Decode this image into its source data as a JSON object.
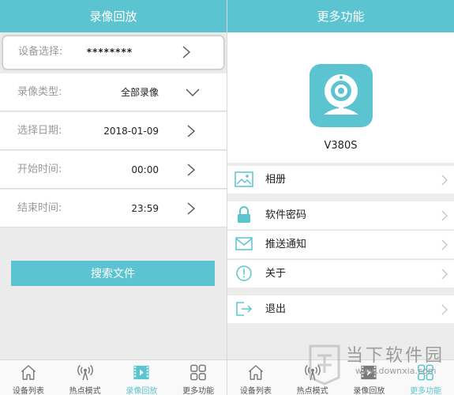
{
  "left": {
    "title": "录像回放",
    "rows": [
      {
        "label": "设备选择:",
        "value": "********"
      },
      {
        "label": "录像类型:",
        "value": "全部录像"
      },
      {
        "label": "选择日期:",
        "value": "2018-01-09"
      },
      {
        "label": "开始时间:",
        "value": "00:00"
      },
      {
        "label": "结束时间:",
        "value": "23:59"
      }
    ],
    "search_label": "搜索文件",
    "nav": [
      "设备列表",
      "热点模式",
      "录像回放",
      "更多功能"
    ],
    "active_nav": "录像回放"
  },
  "right": {
    "title": "更多功能",
    "device_name": "V380S",
    "menu": [
      {
        "icon": "photo-icon",
        "label": "相册"
      },
      {
        "icon": "lock-icon",
        "label": "软件密码"
      },
      {
        "icon": "envelope-icon",
        "label": "推送通知"
      },
      {
        "icon": "info-icon",
        "label": "关于"
      },
      {
        "icon": "logout-icon",
        "label": "退出"
      }
    ],
    "nav": [
      "设备列表",
      "热点模式",
      "录像回放",
      "更多功能"
    ],
    "active_nav": "更多功能"
  },
  "watermark": {
    "text": "当下软件园",
    "url": "www.downxia.com"
  },
  "colors": {
    "accent": "#5bc4d0",
    "background": "#ebebeb",
    "icon_gray": "#8a8a8a"
  }
}
